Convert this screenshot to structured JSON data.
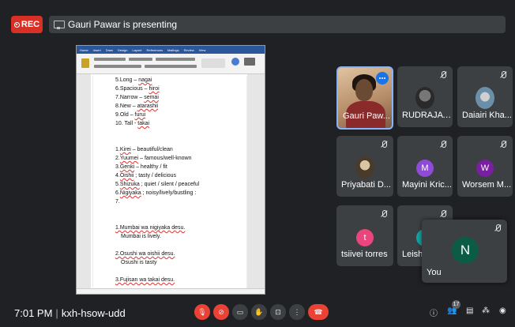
{
  "topbar": {
    "rec_label": "REC",
    "presenting_text": "Gauri Pawar is presenting"
  },
  "document": {
    "ribbon_tabs": [
      "Home",
      "Insert",
      "Draw",
      "Design",
      "Layout",
      "References",
      "Mailings",
      "Review",
      "View"
    ],
    "lines": [
      {
        "num": "5.",
        "word": "Long",
        "sep": " – ",
        "jp": "nagai",
        "rest": ""
      },
      {
        "num": "6.",
        "word": "Spacious",
        "sep": " – ",
        "jp": "hiroi",
        "rest": ""
      },
      {
        "num": "7.",
        "word": "Narrow",
        "sep": " – ",
        "jp": "semai",
        "rest": ""
      },
      {
        "num": "8.",
        "word": "New",
        "sep": " – ",
        "jp": "atarashii",
        "rest": ""
      },
      {
        "num": "9.",
        "word": "Old",
        "sep": " – ",
        "jp": "furui",
        "rest": ""
      },
      {
        "num": "10.",
        "word": "    Tall",
        "sep": " - ",
        "jp": "takai",
        "rest": ""
      }
    ],
    "adjectives": [
      {
        "num": "1.",
        "jp": "Kirei",
        "rest": " – beautiful/clean"
      },
      {
        "num": "2.",
        "jp": "Yuumei",
        "rest": " – famous/well-known"
      },
      {
        "num": "3.",
        "jp": "Genki",
        "rest": " – healthy / fit"
      },
      {
        "num": "4.",
        "jp": "Oishii",
        "rest": " ; tasty / delicious"
      },
      {
        "num": "5.",
        "jp": "Shizuka",
        "rest": " ; quiet / silent / peaceful"
      },
      {
        "num": "6.",
        "jp": "Nigiyaka",
        "rest": " ; noisy/lively/bustling  :"
      },
      {
        "num": "7.",
        "jp": "",
        "rest": ""
      }
    ],
    "sentences": [
      {
        "jp": "1.Mumbai wa nigiyaka desu.",
        "en": "Mumbai is lively."
      },
      {
        "jp": "2.Osushi wa oishii desu.",
        "en": "Osushi is tasty"
      },
      {
        "jp": "3.Fujisan wa takai desu.",
        "en": ""
      }
    ]
  },
  "participants": [
    {
      "name": "Gauri Paw...",
      "type": "speaking"
    },
    {
      "name": "RUDRAJAY...",
      "type": "photo"
    },
    {
      "name": "Daiairi Kha...",
      "type": "photo"
    },
    {
      "name": "Priyabati D...",
      "type": "photo"
    },
    {
      "name": "Mayini Kric...",
      "type": "letter",
      "letter": "M",
      "color": "#8e4bd6"
    },
    {
      "name": "Worsem M...",
      "type": "letter",
      "letter": "W",
      "color": "#7b1fa2"
    },
    {
      "name": "tsiivei torres",
      "type": "letter",
      "letter": "t",
      "color": "#e8467c"
    },
    {
      "name": "Leishi",
      "type": "letter",
      "letter": "",
      "color": "#12a4a4"
    }
  ],
  "self_tile": {
    "name": "You",
    "letter": "N",
    "color": "#0b5b45"
  },
  "bottombar": {
    "time": "7:01 PM",
    "meeting_code": "kxh-hsow-udd",
    "participant_count": "17"
  },
  "colors": {
    "background": "#202124",
    "tile": "#3c4043",
    "rec_red": "#d93025",
    "hangup_red": "#ea4335",
    "speaking_border": "#8ab4f8"
  }
}
